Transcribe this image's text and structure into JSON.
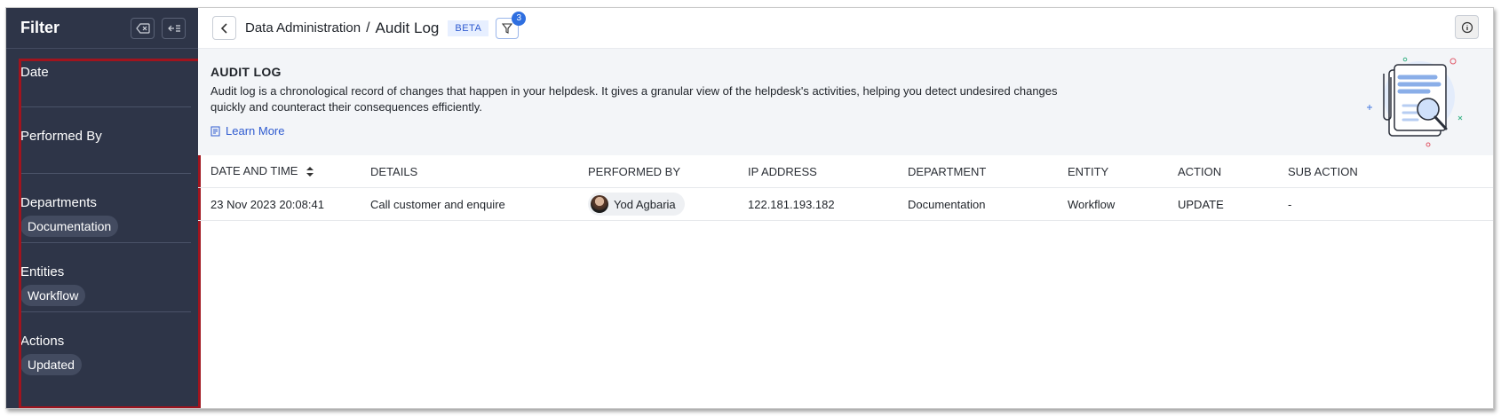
{
  "sidebar": {
    "title": "Filter",
    "sections": [
      {
        "label": "Date",
        "chip": null
      },
      {
        "label": "Performed By",
        "chip": null
      },
      {
        "label": "Departments",
        "chip": "Documentation"
      },
      {
        "label": "Entities",
        "chip": "Workflow"
      },
      {
        "label": "Actions",
        "chip": "Updated"
      }
    ]
  },
  "header": {
    "breadcrumb_parent": "Data Administration",
    "separator": "/",
    "breadcrumb_current": "Audit Log",
    "beta": "BETA",
    "filter_count": "3"
  },
  "banner": {
    "title": "AUDIT LOG",
    "description": "Audit log is a chronological record of changes that happen in your helpdesk. It gives a granular view of the helpdesk's activities, helping you detect undesired changes quickly and counteract their consequences efficiently.",
    "learn_more": "Learn More"
  },
  "table": {
    "columns": [
      "DATE AND TIME",
      "DETAILS",
      "PERFORMED BY",
      "IP ADDRESS",
      "DEPARTMENT",
      "ENTITY",
      "ACTION",
      "SUB ACTION"
    ],
    "rows": [
      {
        "date": "23 Nov 2023 20:08:41",
        "details": "Call customer and enquire",
        "performed_by": "Yod Agbaria",
        "ip": "122.181.193.182",
        "department": "Documentation",
        "entity": "Workflow",
        "action": "UPDATE",
        "sub_action": "-"
      }
    ]
  },
  "colors": {
    "sidebar_bg": "#2e3548",
    "accent": "#2f6fe0",
    "highlight_box": "#a0141e"
  }
}
